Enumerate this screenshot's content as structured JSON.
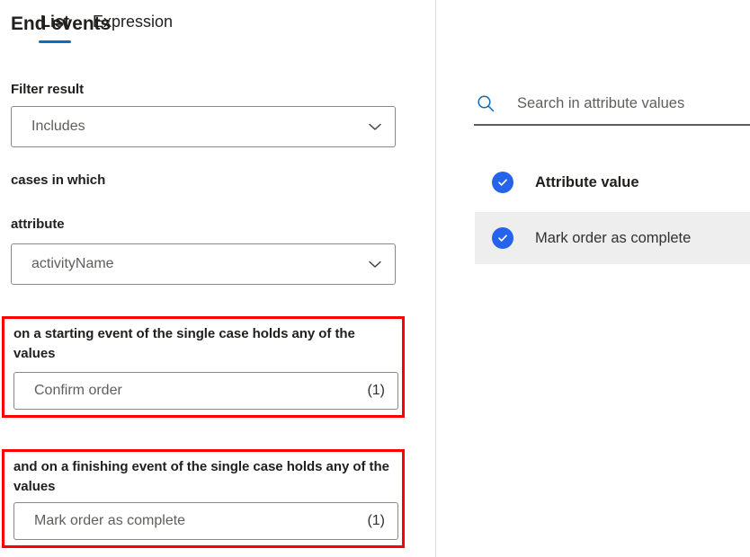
{
  "left_panel": {
    "title": "End events",
    "filter_result": {
      "label": "Filter result",
      "value": "Includes",
      "chevron_icon": "chevron-down-icon"
    },
    "cases_in_which_label": "cases in which",
    "attribute": {
      "label": "attribute",
      "value": "activityName",
      "chevron_icon": "chevron-down-icon"
    },
    "starting_event_group": {
      "label": "on a starting event of the single case holds any of the values",
      "value": "Confirm order",
      "count": "(1)",
      "highlight_color": "#ff0000"
    },
    "finishing_event_group": {
      "label": "and on a finishing event of the single case holds any of the values",
      "value": "Mark order as complete",
      "count": "(1)",
      "highlight_color": "#ff0000"
    }
  },
  "right_panel": {
    "tabs": [
      {
        "label": "List",
        "active": true
      },
      {
        "label": "Expression",
        "active": false
      }
    ],
    "search": {
      "icon": "search-icon",
      "value": "",
      "placeholder": "Search in attribute values",
      "accent_color": "#0f6cbd"
    },
    "list": {
      "header": {
        "label": "Attribute value",
        "checked": true,
        "checkbox_icon": "checkmark-circle-icon"
      },
      "items": [
        {
          "label": "Mark order as complete",
          "checked": true,
          "checkbox_icon": "checkmark-circle-icon",
          "selected": true
        }
      ]
    },
    "checkbox_color": "#2563eb",
    "selected_row_color": "#efeeee"
  }
}
